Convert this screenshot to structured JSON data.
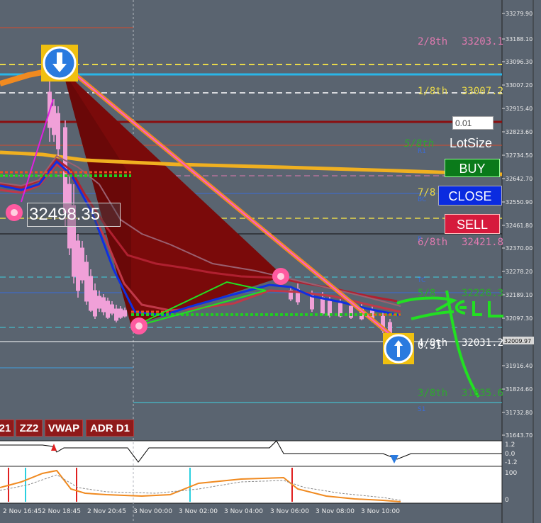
{
  "panel": {
    "lot_input_value": "0.01",
    "lot_label": "LotSize",
    "buy_label": "BUY",
    "close_label": "CLOSE",
    "sell_label": "SELL",
    "buy_color": "#0a7a1a",
    "close_color": "#0a2be0",
    "sell_color": "#d61a3c"
  },
  "price_box": "32498.35",
  "chart_data": {
    "type": "line",
    "price_axis": [
      "33279.90",
      "33188.10",
      "33096.30",
      "33007.20",
      "32915.40",
      "32823.60",
      "32734.50",
      "32642.70",
      "32550.90",
      "32461.80",
      "32370.00",
      "32278.20",
      "32189.10",
      "32097.30",
      "32009.97",
      "31916.40",
      "31824.60",
      "31732.80",
      "31643.70"
    ],
    "current_price": "32009.97",
    "murrey_levels": [
      {
        "label": "2/8th",
        "value": "33203.1",
        "color": "#e07ab0"
      },
      {
        "label": "1/8th",
        "value": "33007.2",
        "color": "#e8d84a"
      },
      {
        "label": "5/8th",
        "value": "",
        "color": "#2ea82e"
      },
      {
        "label": "7/8",
        "value": "",
        "color": "#e8d84a"
      },
      {
        "label": "6/8th",
        "value": "32421.8",
        "color": "#e07ab0"
      },
      {
        "label": "5/8",
        "value": "32226.3",
        "color": "#2ea82e"
      },
      {
        "label": "4/8th",
        "value": "32031.2",
        "color": "#ffffff"
      },
      {
        "label": "3/8th",
        "value": "31835.6",
        "color": "#2ea82e"
      }
    ],
    "pivot_labels": [
      "R1",
      "BC",
      "P",
      "TC",
      "S1"
    ],
    "small_label": "0.31",
    "time_axis": [
      "2 Nov 16:45",
      "2 Nov 18:45",
      "2 Nov 20:45",
      "3 Nov 00:00",
      "3 Nov 02:00",
      "3 Nov 04:00",
      "3 Nov 06:00",
      "3 Nov 08:00",
      "3 Nov 10:00"
    ],
    "indicator_buttons": [
      "21",
      "ZZ2",
      "VWAP",
      "ADR D1"
    ],
    "sub1_axis": [
      "1.2",
      "0.0",
      "-1.2"
    ],
    "sub2_axis": [
      "100",
      "0"
    ]
  }
}
